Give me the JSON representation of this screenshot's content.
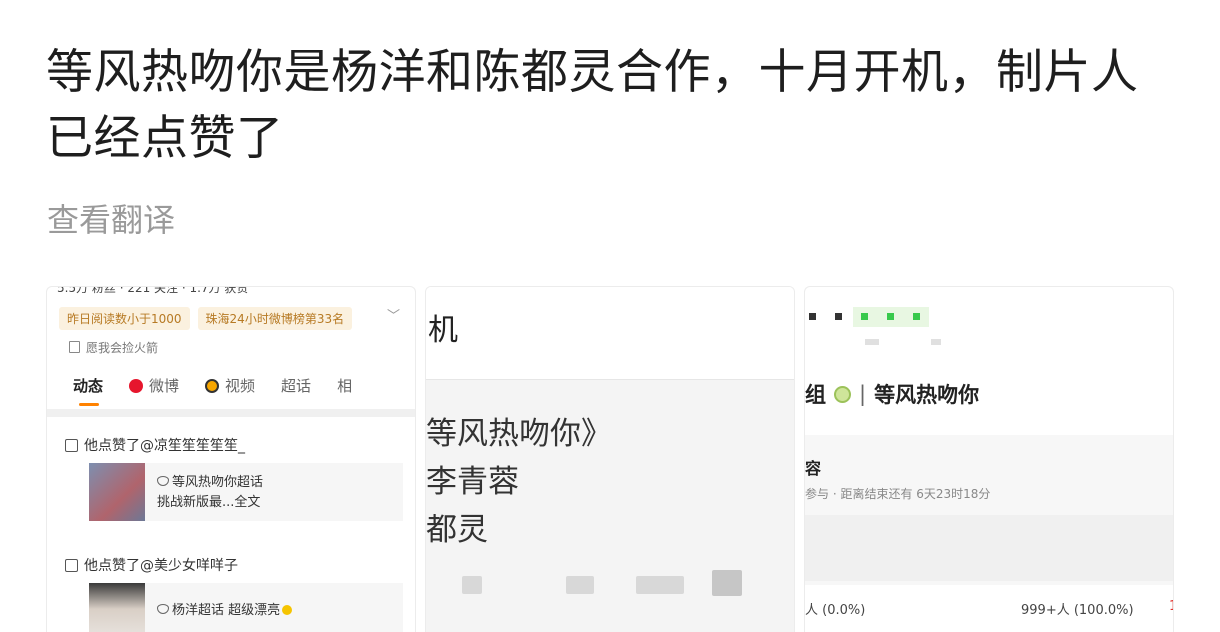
{
  "post": {
    "title": "等风热吻你是杨洋和陈都灵合作，十月开机，制片人已经点赞了",
    "translate_label": "查看翻译"
  },
  "thumb1": {
    "clipped_top_text": "5.5万 粉丝 · 221 关注 · 1.7万 获赞",
    "tags": [
      "昨日阅读数小于1000",
      "珠海24小时微博榜第33名"
    ],
    "signature": "愿我会捡火箭",
    "tabs": [
      "动态",
      "微博",
      "视频",
      "超话",
      "相"
    ],
    "active_tab": "动态",
    "feed": [
      {
        "like_text": "他点赞了@凉笙笙笙笙笙_",
        "card_line1": "等风热吻你超话",
        "card_line2": "挑战新版最...全文"
      },
      {
        "like_text": "他点赞了@美少女咩咩子",
        "card_line1": "杨洋超话  超级漂亮"
      }
    ]
  },
  "thumb2": {
    "top_char": "机",
    "lines": [
      "等风热吻你》",
      "李青蓉",
      "都灵"
    ]
  },
  "thumb3": {
    "title": "等风热吻你",
    "title_prefix": "组",
    "section_heading": "容",
    "meta": "参与 · 距离结束还有 6天23时18分",
    "left_pct": "人 (0.0%)",
    "right_pct": "999+人 (100.0%)",
    "edge_mark": "1"
  },
  "colors": {
    "tag_bg": "#fbf1df",
    "tag_text": "#b77a24",
    "tab_indicator": "#ff8200",
    "green_dot": "#38c94c",
    "translate_gray": "#9a9a9a"
  }
}
